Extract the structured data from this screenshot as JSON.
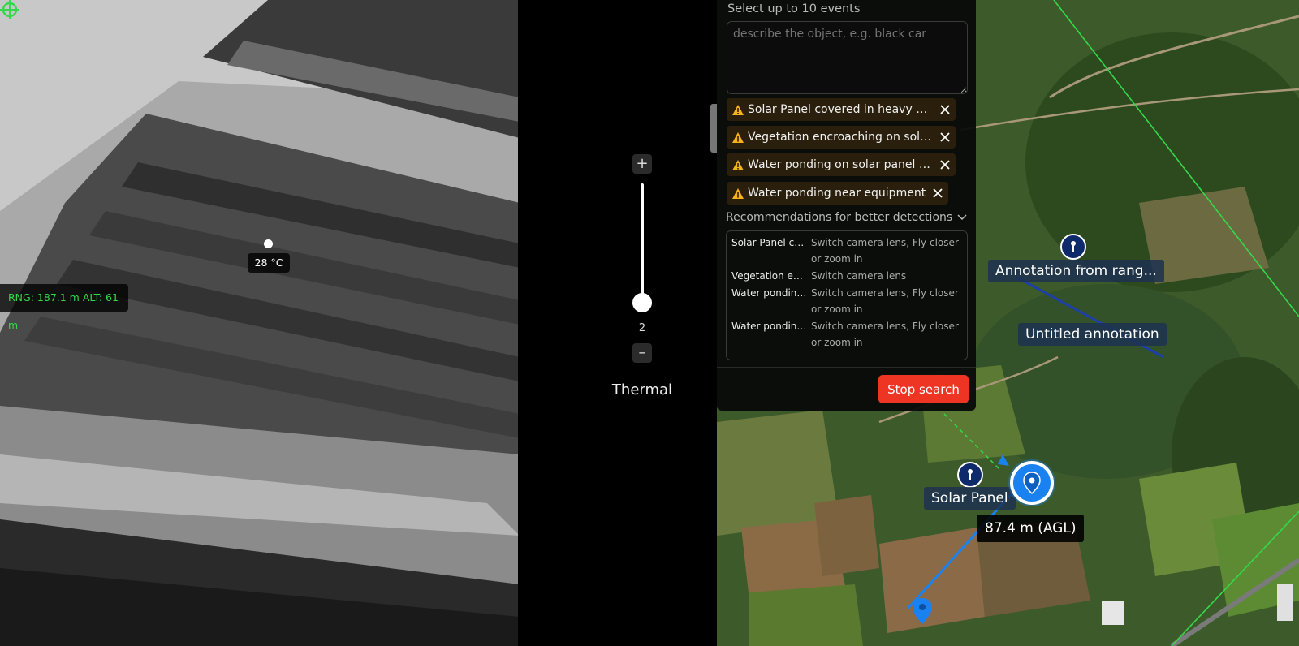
{
  "thermal": {
    "rng_readout": "RNG: 187.1 m ALT: 61 m",
    "temperature": "28 °C"
  },
  "zoom": {
    "plus_label": "+",
    "minus_label": "–",
    "value": "2",
    "mode_label": "Thermal"
  },
  "search_panel": {
    "title": "Select up to 10 events",
    "input_placeholder": "describe the object, e.g. black car",
    "chips": [
      {
        "label": "Solar Panel covered in heavy soiling or dust"
      },
      {
        "label": "Vegetation encroaching on solar panels"
      },
      {
        "label": "Water ponding on solar panel surface"
      },
      {
        "label": "Water ponding near equipment"
      }
    ],
    "recommendations_header": "Recommendations for better detections",
    "recommendations": [
      {
        "event": "Solar Panel covered in heavy soiling",
        "advice": "Switch camera lens, Fly closer or zoom in"
      },
      {
        "event": "Vegetation encroaching",
        "advice": "Switch camera lens"
      },
      {
        "event": "Water ponding on solar panel",
        "advice": "Switch camera lens, Fly closer or zoom in"
      },
      {
        "event": "Water ponding near equipment",
        "advice": "Switch camera lens, Fly closer or zoom in"
      }
    ],
    "stop_label": "Stop search",
    "accent_color": "#ee3524"
  },
  "map": {
    "annotations": [
      {
        "label": "Annotation from rang..."
      },
      {
        "label": "Untitled annotation"
      },
      {
        "label": "Solar Panel"
      }
    ],
    "altitude_readout": "87.4 m (AGL)"
  }
}
